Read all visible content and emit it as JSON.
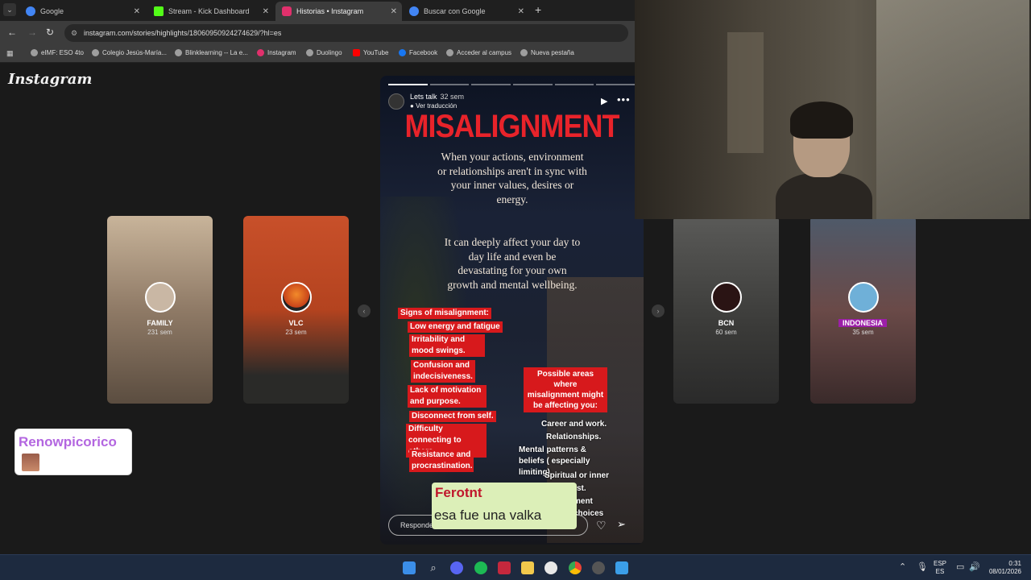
{
  "browser": {
    "tabs": [
      {
        "label": "Google",
        "color": "#4285f4"
      },
      {
        "label": "Stream - Kick Dashboard",
        "color": "#53fc18"
      },
      {
        "label": "Historias • Instagram",
        "color": "#e1306c"
      },
      {
        "label": "Buscar con Google",
        "color": "#4285f4"
      }
    ],
    "url": "instagram.com/stories/highlights/18060950924274629/?hl=es",
    "bookmarks": [
      "eIMF: ESO 4to",
      "Colegio Jesús-María...",
      "Blinklearning -- La e...",
      "Instagram",
      "Duolingo",
      "YouTube",
      "Facebook",
      "Acceder al campus",
      "Nueva pestaña"
    ]
  },
  "instagram": {
    "logo": "Instagram",
    "highlights_left": [
      {
        "name": "FAMILY",
        "time": "231 sem"
      },
      {
        "name": "VLC",
        "time": "23 sem"
      }
    ],
    "highlights_right": [
      {
        "name": "BCN",
        "time": "60 sem"
      },
      {
        "name": "INDONESIA",
        "time": "35 sem"
      }
    ],
    "story": {
      "username": "Lets talk",
      "age": "32 sem",
      "translation": "Ver traducción",
      "headline": "MISALIGNMENT",
      "paragraph1": "When your actions, environment or relationships aren't in sync with your inner values, desires or energy.",
      "paragraph2": "It can deeply affect your day to day life and even be devastating for your own growth and mental wellbeing.",
      "signs_title": "Signs of misalignment:",
      "signs": [
        "Low energy and fatigue",
        "Irritability and mood swings.",
        "Confusion and indecisiveness.",
        "Lack of motivation and purpose.",
        "Disconnect from self.",
        "Difficulty connecting to others.",
        "Resistance and procrastination."
      ],
      "areas_title": "Possible areas where misalignment might be affecting you:",
      "areas": [
        "Career and work.",
        "Relationships.",
        "Mental patterns & beliefs ( especially limiting).",
        "Spiritual or inner",
        "st.",
        "ment",
        "choices"
      ],
      "reply_placeholder": "Responde"
    }
  },
  "chat": {
    "message1_user": "Renowpicorico",
    "message2_user": "Ferotnt",
    "message2_text": "esa fue una valka"
  },
  "taskbar": {
    "lang": "ESP",
    "region": "ES",
    "time": "0:31",
    "date": "08/01/2026"
  }
}
